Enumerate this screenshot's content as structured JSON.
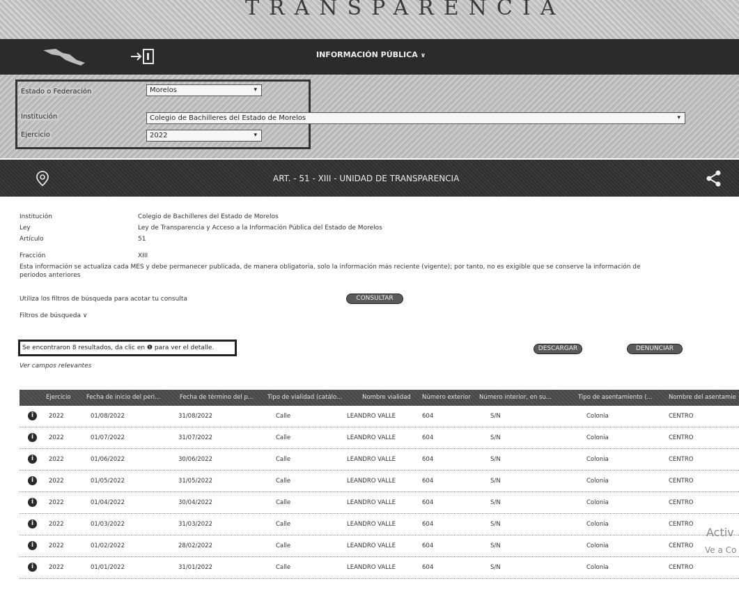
{
  "banner": {
    "title": "TRANSPARENCIA"
  },
  "nav": {
    "menu_label": "INFORMACIÓN PÚBLICA",
    "menu_chevron": "∨"
  },
  "filters": {
    "estado_label": "Estado o Federación",
    "estado_value": "Morelos",
    "institucion_label": "Institución",
    "institucion_value": "Colegio de Bachilleres del Estado de Morelos",
    "ejercicio_label": "Ejercicio",
    "ejercicio_value": "2022"
  },
  "article": {
    "title": "ART. - 51 - XIII - UNIDAD DE TRANSPARENCIA"
  },
  "info": {
    "institucion_key": "Institución",
    "institucion_val": "Colegio de Bachilleres del Estado de Morelos",
    "ley_key": "Ley",
    "ley_val": "Ley de Transparencia y Acceso a la Información Pública del Estado de Morelos",
    "articulo_key": "Artículo",
    "articulo_val": "51",
    "fraccion_key": "Fracción",
    "fraccion_val": "XIII",
    "note": "Esta información se actualiza cada MES y debe permanecer publicada, de manera obligatoria, solo la información más reciente (vigente); por tanto, no es exigible que se conserve la información de periodos anteriores",
    "hint": "Utiliza los filtros de búsqueda para acotar tu consulta",
    "consultar": "CONSULTAR",
    "filtros": "Filtros de búsqueda ∨"
  },
  "results": {
    "text": "Se encontraron 8 resultados, da clic en ❶ para ver el detalle.",
    "relevant": "Ver campos relevantes",
    "descargar": "DESCARGAR",
    "denunciar": "DENUNCIAR"
  },
  "table": {
    "headers": [
      "Ejercicio",
      "Fecha de inicio del peri...",
      "Fecha de término del p...",
      "Tipo de vialidad (catálo...",
      "Nombre vialidad",
      "Número exterior",
      "Número interior, en su...",
      "Tipo de asentamiento (...",
      "Nombre del asentamie"
    ],
    "rows": [
      [
        "2022",
        "01/08/2022",
        "31/08/2022",
        "Calle",
        "LEANDRO VALLE",
        "604",
        "S/N",
        "Colonia",
        "CENTRO"
      ],
      [
        "2022",
        "01/07/2022",
        "31/07/2022",
        "Calle",
        "LEANDRO VALLE",
        "604",
        "S/N",
        "Colonia",
        "CENTRO"
      ],
      [
        "2022",
        "01/06/2022",
        "30/06/2022",
        "Calle",
        "LEANDRO VALLE",
        "604",
        "S/N",
        "Colonia",
        "CENTRO"
      ],
      [
        "2022",
        "01/05/2022",
        "31/05/2022",
        "Calle",
        "LEANDRO VALLE",
        "604",
        "S/N",
        "Colonia",
        "CENTRO"
      ],
      [
        "2022",
        "01/04/2022",
        "30/04/2022",
        "Calle",
        "LEANDRO VALLE",
        "604",
        "S/N",
        "Colonia",
        "CENTRO"
      ],
      [
        "2022",
        "01/03/2022",
        "31/03/2022",
        "Calle",
        "LEANDRO VALLE",
        "604",
        "S/N",
        "Colonia",
        "CENTRO"
      ],
      [
        "2022",
        "01/02/2022",
        "28/02/2022",
        "Calle",
        "LEANDRO VALLE",
        "604",
        "S/N",
        "Colonia",
        "CENTRO"
      ],
      [
        "2022",
        "01/01/2022",
        "31/01/2022",
        "Calle",
        "LEANDRO VALLE",
        "604",
        "S/N",
        "Colonia",
        "CENTRO"
      ]
    ]
  },
  "watermark": {
    "line1": "Activ",
    "line2": "Ve a Co"
  },
  "icons": {
    "info": "info-icon",
    "share": "share-icon",
    "location": "location-pin-icon",
    "login": "login-icon"
  }
}
